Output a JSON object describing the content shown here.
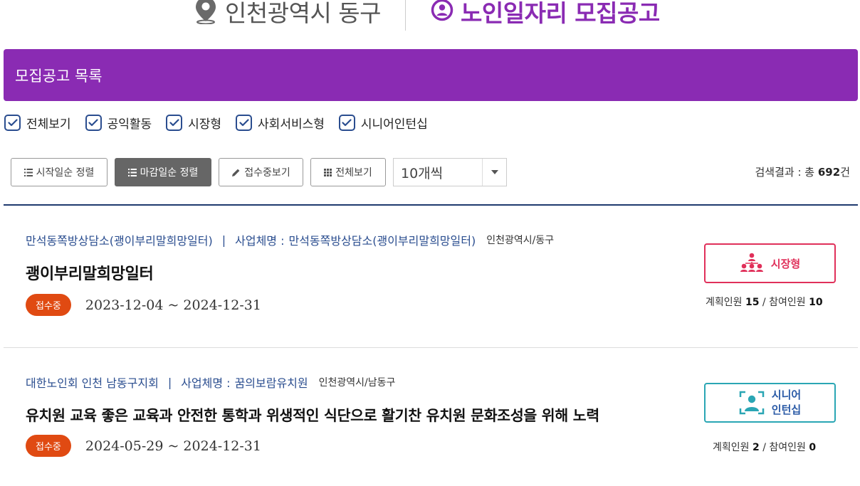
{
  "header": {
    "region": "인천광역시 동구",
    "title": "노인일자리 모집공고"
  },
  "banner": {
    "title": "모집공고 목록"
  },
  "filters": [
    {
      "label": "전체보기",
      "checked": true
    },
    {
      "label": "공익활동",
      "checked": true
    },
    {
      "label": "시장형",
      "checked": true
    },
    {
      "label": "사회서비스형",
      "checked": true
    },
    {
      "label": "시니어인턴십",
      "checked": true
    }
  ],
  "toolbar": {
    "sort_start": "시작일순 정렬",
    "sort_deadline": "마감일순 정렬",
    "view_open": "접수중보기",
    "view_all": "전체보기",
    "page_size": "10개씩"
  },
  "results": {
    "label": "검색결과 : 총",
    "total": "692",
    "unit": "건"
  },
  "listings": [
    {
      "org": "만석동쪽방상담소(괭이부리말희망일터)",
      "company_label": "사업체명 :",
      "company": "만석동쪽방상담소(괭이부리말희망일터)",
      "location": "인천광역시/동구",
      "title": "괭이부리말희망일터",
      "status": "접수중",
      "dates": "2023-12-04 ~ 2024-12-31",
      "type": "시장형",
      "planned_label": "계획인원",
      "planned": "15",
      "participants_label": "참여인원",
      "participants": "10"
    },
    {
      "org": "대한노인회 인천 남동구지회",
      "company_label": "사업체명 :",
      "company": "꿈의보람유치원",
      "location": "인천광역시/남동구",
      "title": "유치원 교육 좋은 교육과 안전한 통학과 위생적인 식단으로 활기찬 유치원 문화조성을 위해 노력",
      "status": "접수중",
      "dates": "2024-05-29 ~ 2024-12-31",
      "type_line1": "시니어",
      "type_line2": "인턴십",
      "planned_label": "계획인원",
      "planned": "2",
      "participants_label": "참여인원",
      "participants": "0"
    }
  ],
  "colors": {
    "brand_purple": "#8a2bb3",
    "link_blue": "#2a4d8f",
    "status_orange": "#e04a12",
    "market_red": "#e0305a",
    "intern_teal": "#2aa6b4"
  }
}
